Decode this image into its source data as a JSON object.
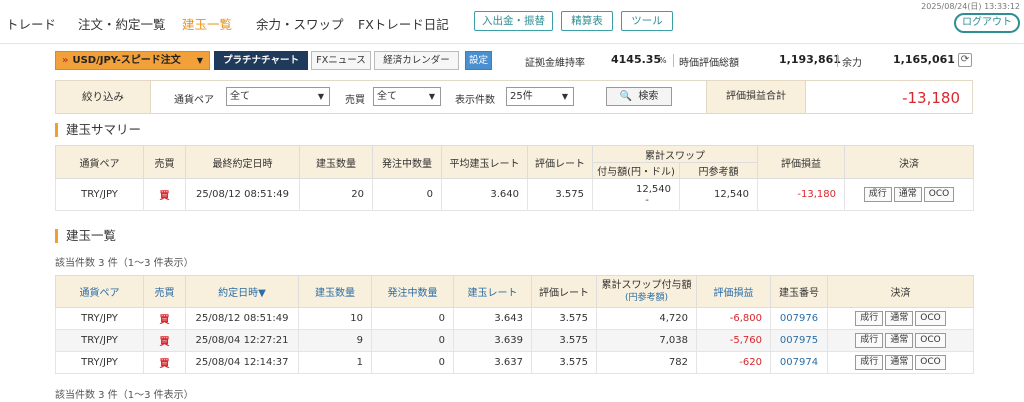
{
  "datetime": "2025/08/24(日) 13:33:12",
  "nav": {
    "items": [
      "トレード",
      "注文・約定一覧",
      "建玉一覧",
      "余力・スワップ",
      "FXトレード日記"
    ],
    "buttons": [
      "入出金・振替",
      "精算表",
      "ツール"
    ],
    "logout": "ログアウト"
  },
  "toolbar": {
    "pair_select": "USD/JPY-スピード注文",
    "platinum_chart": "プラチナチャート",
    "fx_news": "FXニュース",
    "economic_calendar": "経済カレンダー",
    "settings": "設定",
    "margin_label": "証拠金維持率",
    "margin_value": "4145.35",
    "margin_unit": "%",
    "valuation_label": "時価評価総額",
    "valuation_value": "1,193,861",
    "available_label": "余力",
    "available_value": "1,165,061"
  },
  "filter": {
    "label": "絞り込み",
    "pair_label": "通貨ペア",
    "pair_value": "全て",
    "side_label": "売買",
    "side_value": "全て",
    "count_label": "表示件数",
    "count_value": "25件",
    "search": "検索",
    "pl_label": "評価損益合計",
    "pl_value": "-13,180"
  },
  "summary": {
    "title": "建玉サマリー",
    "headers": {
      "pair": "通貨ペア",
      "side": "売買",
      "last_date": "最終約定日時",
      "qty": "建玉数量",
      "pending": "発注中数量",
      "avg_rate": "平均建玉レート",
      "eval_rate": "評価レート",
      "swap": "累計スワップ",
      "swap_grant": "付与額(円・ドル)",
      "swap_ref": "円参考額",
      "pl": "評価損益",
      "settle": "決済"
    },
    "row": {
      "pair": "TRY/JPY",
      "side": "買",
      "last_date": "25/08/12 08:51:49",
      "qty": "20",
      "pending": "0",
      "avg_rate": "3.640",
      "eval_rate": "3.575",
      "swap_grant": "12,540",
      "swap_grant_sub": "-",
      "swap_ref": "12,540",
      "pl": "-13,180"
    }
  },
  "positions": {
    "title": "建玉一覧",
    "count_text": "該当件数 3 件（1～3 件表示）",
    "headers": {
      "pair": "通貨ペア",
      "side": "売買",
      "date": "約定日時▼",
      "qty": "建玉数量",
      "pending": "発注中数量",
      "rate": "建玉レート",
      "eval_rate": "評価レート",
      "swap": "累計スワップ付与額",
      "swap_sub": "(円参考額)",
      "pl": "評価損益",
      "id": "建玉番号",
      "settle": "決済"
    },
    "rows": [
      {
        "pair": "TRY/JPY",
        "side": "買",
        "date": "25/08/12 08:51:49",
        "qty": "10",
        "pending": "0",
        "rate": "3.643",
        "eval_rate": "3.575",
        "swap": "4,720",
        "pl": "-6,800",
        "id": "007976"
      },
      {
        "pair": "TRY/JPY",
        "side": "買",
        "date": "25/08/04 12:27:21",
        "qty": "9",
        "pending": "0",
        "rate": "3.639",
        "eval_rate": "3.575",
        "swap": "7,038",
        "pl": "-5,760",
        "id": "007975"
      },
      {
        "pair": "TRY/JPY",
        "side": "買",
        "date": "25/08/04 12:14:37",
        "qty": "1",
        "pending": "0",
        "rate": "3.637",
        "eval_rate": "3.575",
        "swap": "782",
        "pl": "-620",
        "id": "007974"
      }
    ]
  },
  "settle_buttons": [
    "成行",
    "通常",
    "OCO"
  ],
  "bottom_count_text": "該当件数 3 件（1～3 件表示）"
}
